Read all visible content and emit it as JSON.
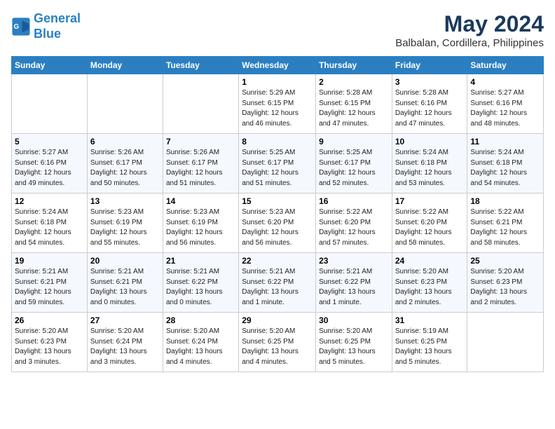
{
  "logo": {
    "line1": "General",
    "line2": "Blue"
  },
  "title": "May 2024",
  "location": "Balbalan, Cordillera, Philippines",
  "weekdays": [
    "Sunday",
    "Monday",
    "Tuesday",
    "Wednesday",
    "Thursday",
    "Friday",
    "Saturday"
  ],
  "weeks": [
    [
      {
        "day": "",
        "info": ""
      },
      {
        "day": "",
        "info": ""
      },
      {
        "day": "",
        "info": ""
      },
      {
        "day": "1",
        "info": "Sunrise: 5:29 AM\nSunset: 6:15 PM\nDaylight: 12 hours\nand 46 minutes."
      },
      {
        "day": "2",
        "info": "Sunrise: 5:28 AM\nSunset: 6:15 PM\nDaylight: 12 hours\nand 47 minutes."
      },
      {
        "day": "3",
        "info": "Sunrise: 5:28 AM\nSunset: 6:16 PM\nDaylight: 12 hours\nand 47 minutes."
      },
      {
        "day": "4",
        "info": "Sunrise: 5:27 AM\nSunset: 6:16 PM\nDaylight: 12 hours\nand 48 minutes."
      }
    ],
    [
      {
        "day": "5",
        "info": "Sunrise: 5:27 AM\nSunset: 6:16 PM\nDaylight: 12 hours\nand 49 minutes."
      },
      {
        "day": "6",
        "info": "Sunrise: 5:26 AM\nSunset: 6:17 PM\nDaylight: 12 hours\nand 50 minutes."
      },
      {
        "day": "7",
        "info": "Sunrise: 5:26 AM\nSunset: 6:17 PM\nDaylight: 12 hours\nand 51 minutes."
      },
      {
        "day": "8",
        "info": "Sunrise: 5:25 AM\nSunset: 6:17 PM\nDaylight: 12 hours\nand 51 minutes."
      },
      {
        "day": "9",
        "info": "Sunrise: 5:25 AM\nSunset: 6:17 PM\nDaylight: 12 hours\nand 52 minutes."
      },
      {
        "day": "10",
        "info": "Sunrise: 5:24 AM\nSunset: 6:18 PM\nDaylight: 12 hours\nand 53 minutes."
      },
      {
        "day": "11",
        "info": "Sunrise: 5:24 AM\nSunset: 6:18 PM\nDaylight: 12 hours\nand 54 minutes."
      }
    ],
    [
      {
        "day": "12",
        "info": "Sunrise: 5:24 AM\nSunset: 6:18 PM\nDaylight: 12 hours\nand 54 minutes."
      },
      {
        "day": "13",
        "info": "Sunrise: 5:23 AM\nSunset: 6:19 PM\nDaylight: 12 hours\nand 55 minutes."
      },
      {
        "day": "14",
        "info": "Sunrise: 5:23 AM\nSunset: 6:19 PM\nDaylight: 12 hours\nand 56 minutes."
      },
      {
        "day": "15",
        "info": "Sunrise: 5:23 AM\nSunset: 6:20 PM\nDaylight: 12 hours\nand 56 minutes."
      },
      {
        "day": "16",
        "info": "Sunrise: 5:22 AM\nSunset: 6:20 PM\nDaylight: 12 hours\nand 57 minutes."
      },
      {
        "day": "17",
        "info": "Sunrise: 5:22 AM\nSunset: 6:20 PM\nDaylight: 12 hours\nand 58 minutes."
      },
      {
        "day": "18",
        "info": "Sunrise: 5:22 AM\nSunset: 6:21 PM\nDaylight: 12 hours\nand 58 minutes."
      }
    ],
    [
      {
        "day": "19",
        "info": "Sunrise: 5:21 AM\nSunset: 6:21 PM\nDaylight: 12 hours\nand 59 minutes."
      },
      {
        "day": "20",
        "info": "Sunrise: 5:21 AM\nSunset: 6:21 PM\nDaylight: 13 hours\nand 0 minutes."
      },
      {
        "day": "21",
        "info": "Sunrise: 5:21 AM\nSunset: 6:22 PM\nDaylight: 13 hours\nand 0 minutes."
      },
      {
        "day": "22",
        "info": "Sunrise: 5:21 AM\nSunset: 6:22 PM\nDaylight: 13 hours\nand 1 minute."
      },
      {
        "day": "23",
        "info": "Sunrise: 5:21 AM\nSunset: 6:22 PM\nDaylight: 13 hours\nand 1 minute."
      },
      {
        "day": "24",
        "info": "Sunrise: 5:20 AM\nSunset: 6:23 PM\nDaylight: 13 hours\nand 2 minutes."
      },
      {
        "day": "25",
        "info": "Sunrise: 5:20 AM\nSunset: 6:23 PM\nDaylight: 13 hours\nand 2 minutes."
      }
    ],
    [
      {
        "day": "26",
        "info": "Sunrise: 5:20 AM\nSunset: 6:23 PM\nDaylight: 13 hours\nand 3 minutes."
      },
      {
        "day": "27",
        "info": "Sunrise: 5:20 AM\nSunset: 6:24 PM\nDaylight: 13 hours\nand 3 minutes."
      },
      {
        "day": "28",
        "info": "Sunrise: 5:20 AM\nSunset: 6:24 PM\nDaylight: 13 hours\nand 4 minutes."
      },
      {
        "day": "29",
        "info": "Sunrise: 5:20 AM\nSunset: 6:25 PM\nDaylight: 13 hours\nand 4 minutes."
      },
      {
        "day": "30",
        "info": "Sunrise: 5:20 AM\nSunset: 6:25 PM\nDaylight: 13 hours\nand 5 minutes."
      },
      {
        "day": "31",
        "info": "Sunrise: 5:19 AM\nSunset: 6:25 PM\nDaylight: 13 hours\nand 5 minutes."
      },
      {
        "day": "",
        "info": ""
      }
    ]
  ]
}
